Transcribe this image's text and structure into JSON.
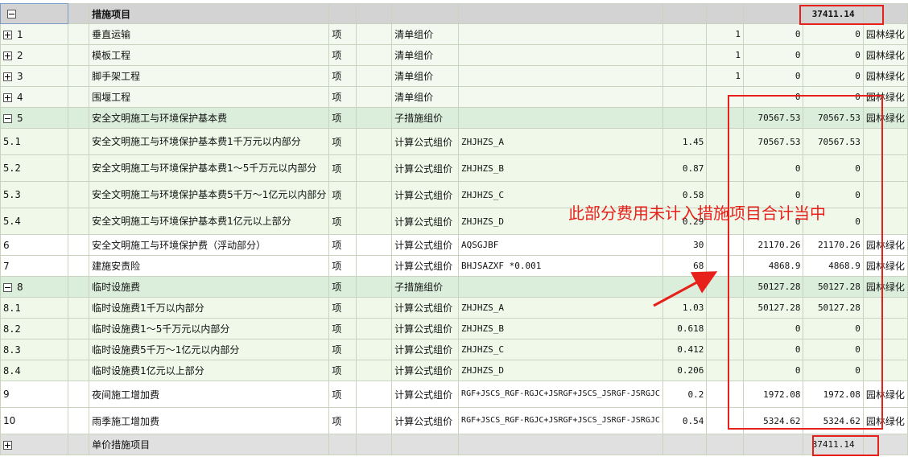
{
  "header": {
    "expander": "minus",
    "name": "措施项目",
    "total": "37411.14"
  },
  "rows": [
    {
      "kind": "plain",
      "expander": "plus",
      "code": "1",
      "name": "垂直运输",
      "unit": "项",
      "type": "清单组价",
      "formula": "",
      "rate": "",
      "qty": "1",
      "price": "0",
      "amount": "0",
      "tail": "园林绿化"
    },
    {
      "kind": "plain",
      "expander": "plus",
      "code": "2",
      "name": "模板工程",
      "unit": "项",
      "type": "清单组价",
      "formula": "",
      "rate": "",
      "qty": "1",
      "price": "0",
      "amount": "0",
      "tail": "园林绿化"
    },
    {
      "kind": "plain",
      "expander": "plus",
      "code": "3",
      "name": "脚手架工程",
      "unit": "项",
      "type": "清单组价",
      "formula": "",
      "rate": "",
      "qty": "1",
      "price": "0",
      "amount": "0",
      "tail": "园林绿化"
    },
    {
      "kind": "plain",
      "expander": "plus",
      "code": "4",
      "name": "围堰工程",
      "unit": "项",
      "type": "清单组价",
      "formula": "",
      "rate": "",
      "qty": "",
      "price": "0",
      "amount": "0",
      "tail": "园林绿化"
    },
    {
      "kind": "parent",
      "expander": "minus",
      "code": "5",
      "name": "安全文明施工与环境保护基本费",
      "unit": "项",
      "type": "子措施组价",
      "formula": "",
      "rate": "",
      "qty": "",
      "price": "70567.53",
      "amount": "70567.53",
      "tail": "园林绿化"
    },
    {
      "kind": "child",
      "expander": "",
      "code": "5.1",
      "name": "安全文明施工与环境保护基本费1千万元以内部分",
      "unit": "项",
      "type": "计算公式组价",
      "formula": "ZHJHZS_A",
      "rate": "1.45",
      "qty": "",
      "price": "70567.53",
      "amount": "70567.53",
      "tail": ""
    },
    {
      "kind": "child",
      "expander": "",
      "code": "5.2",
      "name": "安全文明施工与环境保护基本费1～5千万元以内部分",
      "unit": "项",
      "type": "计算公式组价",
      "formula": "ZHJHZS_B",
      "rate": "0.87",
      "qty": "",
      "price": "0",
      "amount": "0",
      "tail": ""
    },
    {
      "kind": "child",
      "expander": "",
      "code": "5.3",
      "name": "安全文明施工与环境保护基本费5千万～1亿元以内部分",
      "unit": "项",
      "type": "计算公式组价",
      "formula": "ZHJHZS_C",
      "rate": "0.58",
      "qty": "",
      "price": "0",
      "amount": "0",
      "tail": ""
    },
    {
      "kind": "child",
      "expander": "",
      "code": "5.4",
      "name": "安全文明施工与环境保护基本费1亿元以上部分",
      "unit": "项",
      "type": "计算公式组价",
      "formula": "ZHJHZS_D",
      "rate": "0.29",
      "qty": "",
      "price": "0",
      "amount": "0",
      "tail": ""
    },
    {
      "kind": "leaf",
      "expander": "",
      "code": "6",
      "name": "安全文明施工与环境保护费（浮动部分）",
      "unit": "项",
      "type": "计算公式组价",
      "formula": "AQSGJBF",
      "rate": "30",
      "qty": "",
      "price": "21170.26",
      "amount": "21170.26",
      "tail": "园林绿化"
    },
    {
      "kind": "leaf",
      "expander": "",
      "code": "7",
      "name": "建施安责险",
      "unit": "项",
      "type": "计算公式组价",
      "formula": "BHJSAZXF *0.001",
      "rate": "68",
      "qty": "",
      "price": "4868.9",
      "amount": "4868.9",
      "tail": "园林绿化"
    },
    {
      "kind": "parent",
      "expander": "minus",
      "code": "8",
      "name": "临时设施费",
      "unit": "项",
      "type": "子措施组价",
      "formula": "",
      "rate": "",
      "qty": "",
      "price": "50127.28",
      "amount": "50127.28",
      "tail": "园林绿化"
    },
    {
      "kind": "child",
      "expander": "",
      "code": "8.1",
      "name": "临时设施费1千万以内部分",
      "unit": "项",
      "type": "计算公式组价",
      "formula": "ZHJHZS_A",
      "rate": "1.03",
      "qty": "",
      "price": "50127.28",
      "amount": "50127.28",
      "tail": ""
    },
    {
      "kind": "child",
      "expander": "",
      "code": "8.2",
      "name": "临时设施费1～5千万元以内部分",
      "unit": "项",
      "type": "计算公式组价",
      "formula": "ZHJHZS_B",
      "rate": "0.618",
      "qty": "",
      "price": "0",
      "amount": "0",
      "tail": ""
    },
    {
      "kind": "child",
      "expander": "",
      "code": "8.3",
      "name": "临时设施费5千万～1亿元以内部分",
      "unit": "项",
      "type": "计算公式组价",
      "formula": "ZHJHZS_C",
      "rate": "0.412",
      "qty": "",
      "price": "0",
      "amount": "0",
      "tail": ""
    },
    {
      "kind": "child",
      "expander": "",
      "code": "8.4",
      "name": "临时设施费1亿元以上部分",
      "unit": "项",
      "type": "计算公式组价",
      "formula": "ZHJHZS_D",
      "rate": "0.206",
      "qty": "",
      "price": "0",
      "amount": "0",
      "tail": ""
    },
    {
      "kind": "leaf",
      "expander": "",
      "code": "9",
      "name": "夜间施工增加费",
      "unit": "项",
      "type": "计算公式组价",
      "formula": "RGF+JSCS_RGF-RGJC+JSRGF+JSCS_JSRGF-JSRGJC",
      "rate": "0.2",
      "qty": "",
      "price": "1972.08",
      "amount": "1972.08",
      "tail": "园林绿化"
    },
    {
      "kind": "leaf",
      "expander": "",
      "code": "10",
      "name": "雨季施工增加费",
      "unit": "项",
      "type": "计算公式组价",
      "formula": "RGF+JSCS_RGF-RGJC+JSRGF+JSCS_JSRGF-JSRGJC",
      "rate": "0.54",
      "qty": "",
      "price": "5324.62",
      "amount": "5324.62",
      "tail": "园林绿化"
    }
  ],
  "footer": {
    "expander": "plus",
    "name": "单价措施项目",
    "total": "37411.14"
  },
  "annotation": {
    "text": "此部分费用未计入措施项目合计当中",
    "color": "#e8201c"
  }
}
